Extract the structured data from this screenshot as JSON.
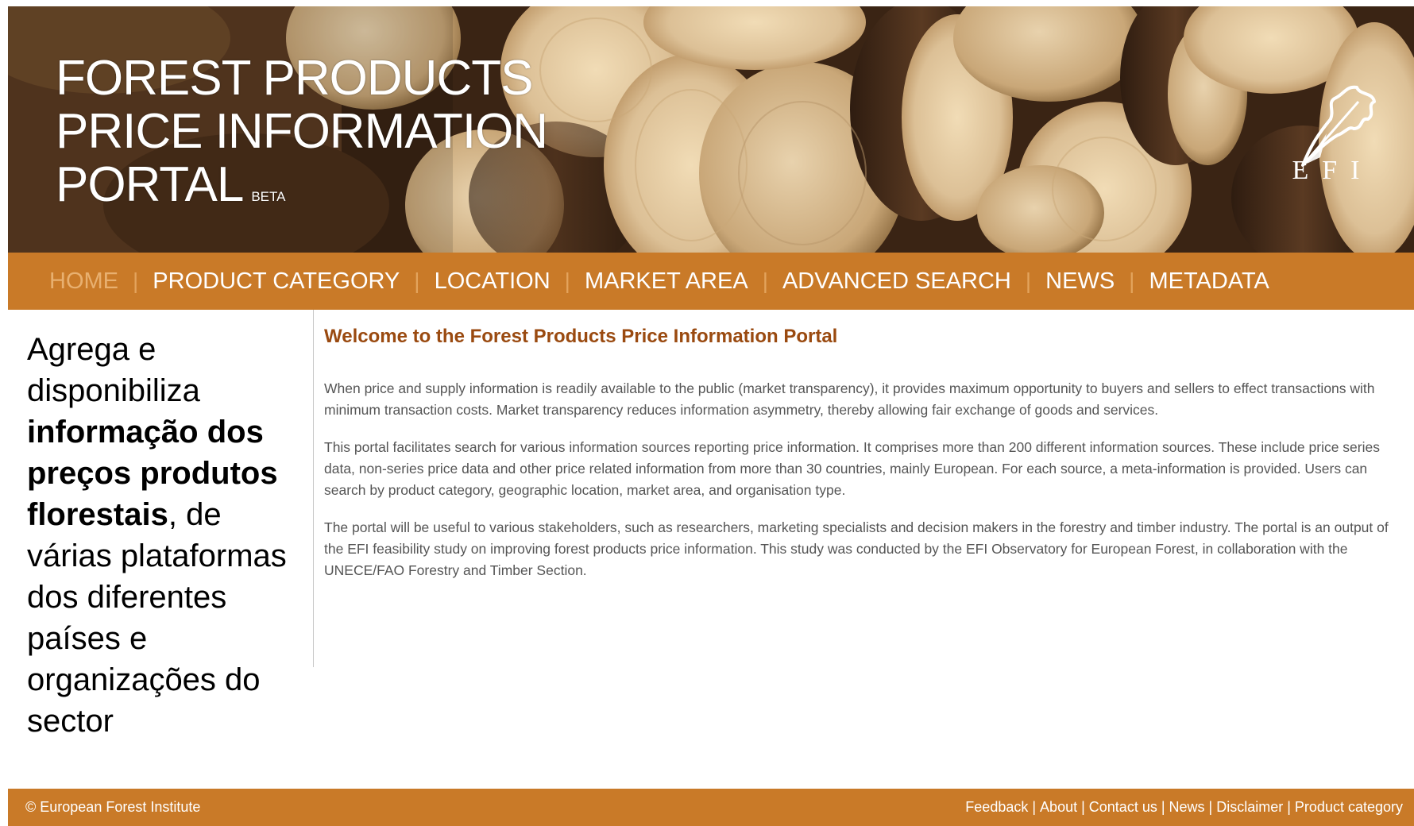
{
  "banner": {
    "title_line1": "FOREST PRODUCTS",
    "title_line2": "PRICE INFORMATION",
    "title_line3": "PORTAL",
    "beta": "BETA",
    "logo_text": "EFI"
  },
  "nav": {
    "items": [
      {
        "label": "HOME",
        "active": true
      },
      {
        "label": "PRODUCT CATEGORY"
      },
      {
        "label": "LOCATION"
      },
      {
        "label": "MARKET AREA"
      },
      {
        "label": "ADVANCED SEARCH"
      },
      {
        "label": "NEWS"
      },
      {
        "label": "METADATA"
      }
    ],
    "separator": "|"
  },
  "annotation": {
    "part1": "Agrega e disponibiliza ",
    "bold": "informação dos preços produtos florestais",
    "part2": ", de várias plataformas dos diferentes países e organizações do sector"
  },
  "main": {
    "title": "Welcome to the Forest Products Price Information Portal",
    "paragraphs": [
      "When price and supply information is readily available to the public (market transparency), it provides maximum opportunity to buyers and sellers to effect transactions with minimum transaction costs. Market transparency reduces information asymmetry, thereby allowing fair exchange of goods and services.",
      "This portal facilitates search for various information sources reporting price information. It comprises more than 200 different information sources. These include price series data, non-series price data and other price related information from more than 30 countries, mainly European. For each source, a meta-information is provided. Users can search by product category, geographic location, market area, and organisation type.",
      "The portal will be useful to various stakeholders, such as researchers, marketing specialists and decision makers in the forestry and timber industry. The portal is an output of the EFI feasibility study on improving forest products price information. This study was conducted by the EFI Observatory for European Forest, in collaboration with the UNECE/FAO Forestry and Timber Section."
    ]
  },
  "footer": {
    "copyright": "© European Forest Institute",
    "links": [
      "Feedback",
      "About",
      "Contact us",
      "News",
      "Disclaimer",
      "Product category"
    ],
    "separator": "|"
  },
  "colors": {
    "nav_bg": "#c97a28",
    "title_brown": "#9a4a10",
    "home_active": "#e8b070"
  }
}
